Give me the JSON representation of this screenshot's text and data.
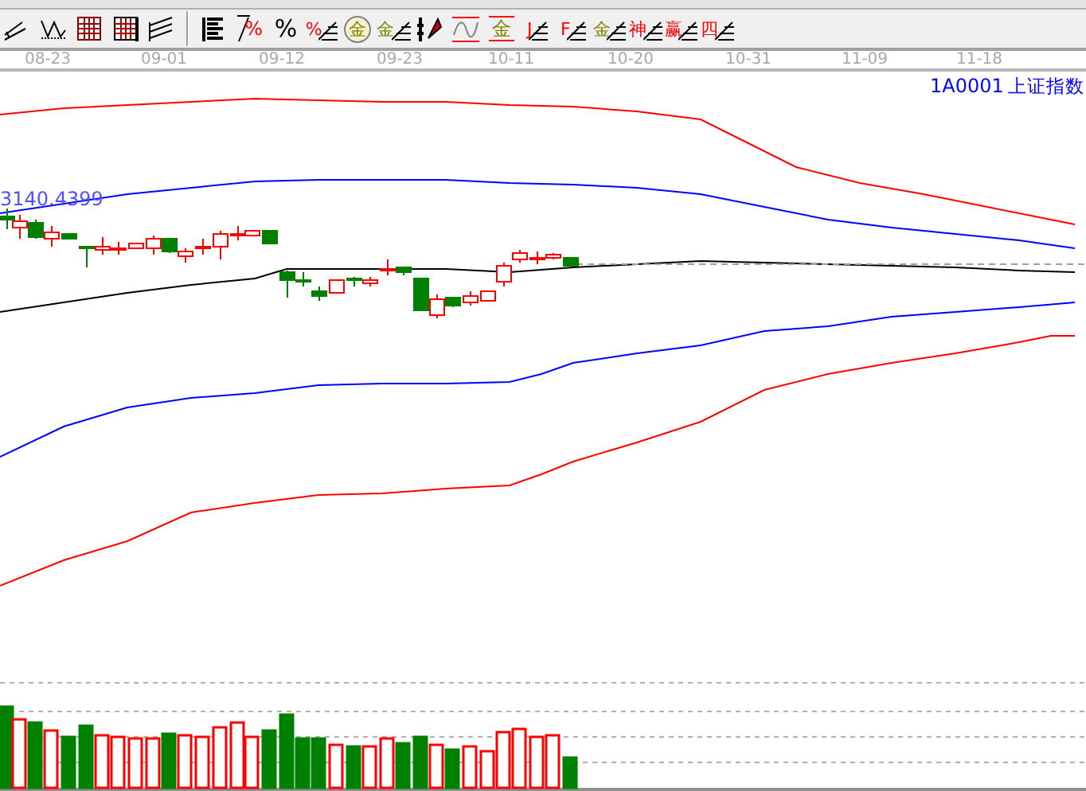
{
  "toolbar": [
    {
      "kind": "icon"
    },
    {
      "kind": "icon"
    },
    {
      "kind": "icon"
    },
    {
      "kind": "icon"
    },
    {
      "kind": "icon"
    },
    {
      "kind": "separator"
    },
    {
      "kind": "icon"
    },
    {
      "kind": "glyph-slash",
      "text": "%",
      "color": "#ff0000"
    },
    {
      "kind": "glyph",
      "text": "%",
      "color": "#000000"
    },
    {
      "kind": "glyph-lines",
      "text": "%",
      "color": "#ff0000"
    },
    {
      "kind": "glyph-circle",
      "text": "金",
      "color": "#808000"
    },
    {
      "kind": "glyph-lines",
      "text": "金",
      "color": "#808000"
    },
    {
      "kind": "icon"
    },
    {
      "kind": "icon"
    },
    {
      "kind": "glyph-bar",
      "text": "金",
      "color": "#808000"
    },
    {
      "kind": "glyph-lines",
      "text": "J",
      "color": "#ff0000"
    },
    {
      "kind": "glyph-lines",
      "text": "F",
      "color": "#ff0000"
    },
    {
      "kind": "glyph-lines",
      "text": "金",
      "color": "#808000"
    },
    {
      "kind": "glyph-lines",
      "text": "神",
      "color": "#ff0000"
    },
    {
      "kind": "glyph-lines",
      "text": "赢",
      "color": "#ff0000"
    },
    {
      "kind": "glyph-lines",
      "text": "四",
      "color": "#ff0000"
    }
  ],
  "date_axis": [
    "08-23",
    "09-01",
    "09-12",
    "09-23",
    "10-11",
    "10-20",
    "10-31",
    "11-09",
    "11-18"
  ],
  "chart": {
    "symbol": "1A0001",
    "name": "上证指数",
    "price_label": "3140.4399"
  }
}
